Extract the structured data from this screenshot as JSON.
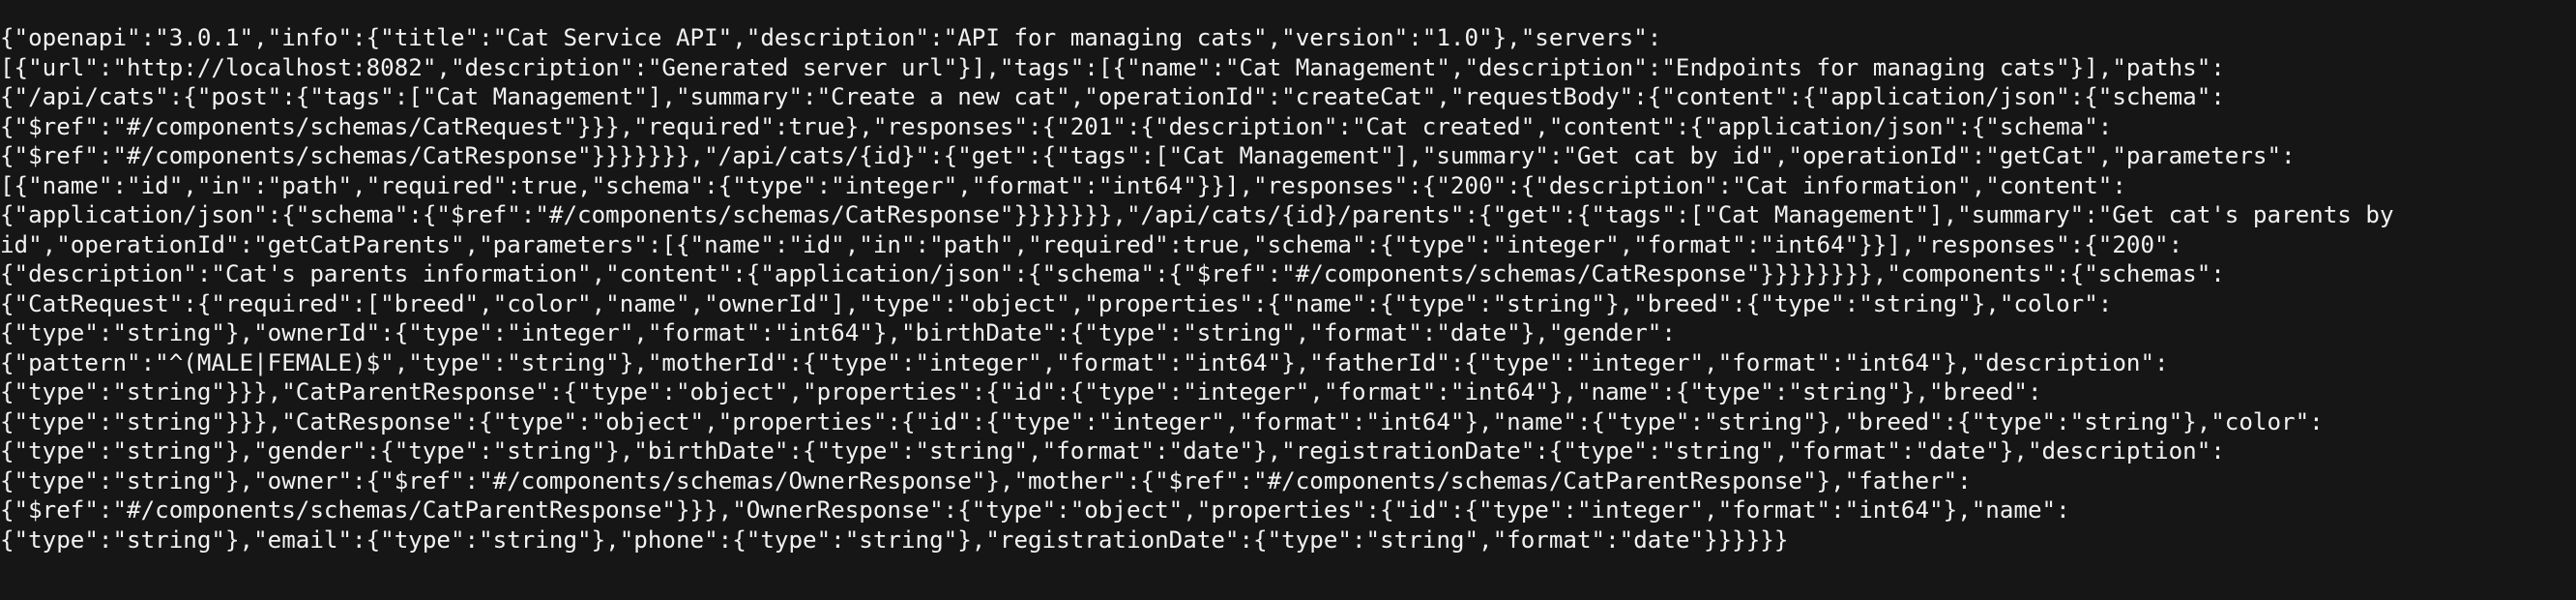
{
  "terminal": {
    "output_lines": [
      "{\"openapi\":\"3.0.1\",\"info\":{\"title\":\"Cat Service API\",\"description\":\"API for managing cats\",\"version\":\"1.0\"},\"servers\":",
      "[{\"url\":\"http://localhost:8082\",\"description\":\"Generated server url\"}],\"tags\":[{\"name\":\"Cat Management\",\"description\":\"Endpoints for managing cats\"}],\"paths\":",
      "{\"/api/cats\":{\"post\":{\"tags\":[\"Cat Management\"],\"summary\":\"Create a new cat\",\"operationId\":\"createCat\",\"requestBody\":{\"content\":{\"application/json\":{\"schema\":",
      "{\"$ref\":\"#/components/schemas/CatRequest\"}}},\"required\":true},\"responses\":{\"201\":{\"description\":\"Cat created\",\"content\":{\"application/json\":{\"schema\":",
      "{\"$ref\":\"#/components/schemas/CatResponse\"}}}}}}},\"/api/cats/{id}\":{\"get\":{\"tags\":[\"Cat Management\"],\"summary\":\"Get cat by id\",\"operationId\":\"getCat\",\"parameters\":",
      "[{\"name\":\"id\",\"in\":\"path\",\"required\":true,\"schema\":{\"type\":\"integer\",\"format\":\"int64\"}}],\"responses\":{\"200\":{\"description\":\"Cat information\",\"content\":",
      "{\"application/json\":{\"schema\":{\"$ref\":\"#/components/schemas/CatResponse\"}}}}}}},\"/api/cats/{id}/parents\":{\"get\":{\"tags\":[\"Cat Management\"],\"summary\":\"Get cat's parents by",
      "id\",\"operationId\":\"getCatParents\",\"parameters\":[{\"name\":\"id\",\"in\":\"path\",\"required\":true,\"schema\":{\"type\":\"integer\",\"format\":\"int64\"}}],\"responses\":{\"200\":",
      "{\"description\":\"Cat's parents information\",\"content\":{\"application/json\":{\"schema\":{\"$ref\":\"#/components/schemas/CatResponse\"}}}}}}}},\"components\":{\"schemas\":",
      "{\"CatRequest\":{\"required\":[\"breed\",\"color\",\"name\",\"ownerId\"],\"type\":\"object\",\"properties\":{\"name\":{\"type\":\"string\"},\"breed\":{\"type\":\"string\"},\"color\":",
      "{\"type\":\"string\"},\"ownerId\":{\"type\":\"integer\",\"format\":\"int64\"},\"birthDate\":{\"type\":\"string\",\"format\":\"date\"},\"gender\":",
      "{\"pattern\":\"^(MALE|FEMALE)$\",\"type\":\"string\"},\"motherId\":{\"type\":\"integer\",\"format\":\"int64\"},\"fatherId\":{\"type\":\"integer\",\"format\":\"int64\"},\"description\":",
      "{\"type\":\"string\"}}},\"CatParentResponse\":{\"type\":\"object\",\"properties\":{\"id\":{\"type\":\"integer\",\"format\":\"int64\"},\"name\":{\"type\":\"string\"},\"breed\":",
      "{\"type\":\"string\"}}},\"CatResponse\":{\"type\":\"object\",\"properties\":{\"id\":{\"type\":\"integer\",\"format\":\"int64\"},\"name\":{\"type\":\"string\"},\"breed\":{\"type\":\"string\"},\"color\":",
      "{\"type\":\"string\"},\"gender\":{\"type\":\"string\"},\"birthDate\":{\"type\":\"string\",\"format\":\"date\"},\"registrationDate\":{\"type\":\"string\",\"format\":\"date\"},\"description\":",
      "{\"type\":\"string\"},\"owner\":{\"$ref\":\"#/components/schemas/OwnerResponse\"},\"mother\":{\"$ref\":\"#/components/schemas/CatParentResponse\"},\"father\":",
      "{\"$ref\":\"#/components/schemas/CatParentResponse\"}}},\"OwnerResponse\":{\"type\":\"object\",\"properties\":{\"id\":{\"type\":\"integer\",\"format\":\"int64\"},\"name\":",
      "{\"type\":\"string\"},\"email\":{\"type\":\"string\"},\"phone\":{\"type\":\"string\"},\"registrationDate\":{\"type\":\"string\",\"format\":\"date\"}}}}}}"
    ],
    "colors": {
      "background": "#161616",
      "text": "#f2f2f2"
    }
  }
}
